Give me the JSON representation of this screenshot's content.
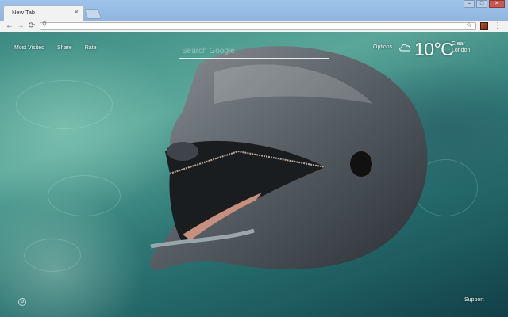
{
  "browser": {
    "tab_title": "New Tab",
    "tab_close": "×",
    "address_value": "",
    "window_buttons": {
      "minimize": "–",
      "restore": "□",
      "close": "✕"
    }
  },
  "toolbar": {
    "back": "←",
    "forward": "→",
    "reload": "⟳",
    "search_glyph": "⚲",
    "star": "☆",
    "menu": "⋮"
  },
  "page": {
    "links": [
      "Most Visited",
      "Share",
      "Rate"
    ],
    "search_placeholder": "Search Google",
    "options_label": "Options",
    "weather": {
      "temperature": "10°C",
      "condition": "Clear",
      "location": "London",
      "icon": "cloud-icon"
    },
    "support_label": "Support",
    "bottom_icon": "⚙"
  },
  "colors": {
    "water": "#3c8a82",
    "titlebar": "#9ec3ea",
    "close_button": "#c8594f"
  }
}
